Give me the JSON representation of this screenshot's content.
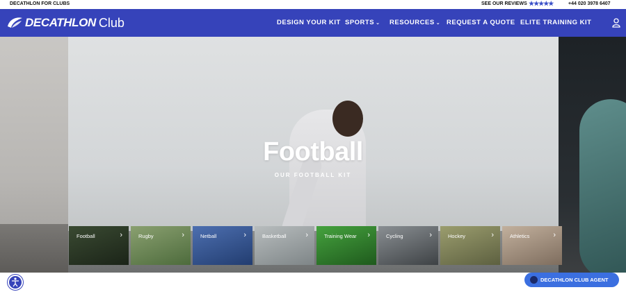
{
  "topbar": {
    "left_text": "DECATHLON FOR CLUBS",
    "reviews_text": "SEE OUR REVIEWS",
    "stars": "★★★★★",
    "phone": "+44 020 3978 6407"
  },
  "nav": {
    "brand": "DECATHLON",
    "club": "Club",
    "items": [
      {
        "label": "DESIGN YOUR KIT",
        "chevron": ""
      },
      {
        "label": "SPORTS",
        "chevron": "⌄"
      },
      {
        "label": "RESOURCES",
        "chevron": "⌄"
      },
      {
        "label": "REQUEST A QUOTE",
        "chevron": ""
      },
      {
        "label": "ELITE TRAINING KIT",
        "chevron": ""
      }
    ]
  },
  "hero": {
    "title": "Football",
    "subtitle": "OUR FOOTBALL KIT"
  },
  "tiles": [
    {
      "label": "Football",
      "color": "#2c3a26"
    },
    {
      "label": "Rugby",
      "color": "#6f8a57"
    },
    {
      "label": "Netball",
      "color": "#2f4f8a"
    },
    {
      "label": "Basketball",
      "color": "#9aa0a2"
    },
    {
      "label": "Training Wear",
      "color": "#2f7a2c"
    },
    {
      "label": "Cycling",
      "color": "#5a5e62"
    },
    {
      "label": "Hockey",
      "color": "#7c7f52"
    },
    {
      "label": "Athletics",
      "color": "#a39282"
    }
  ],
  "agent_button": {
    "label": "DECATHLON CLUB AGENT"
  },
  "colors": {
    "brand": "#3643ba",
    "agent": "#3b6fe0"
  }
}
